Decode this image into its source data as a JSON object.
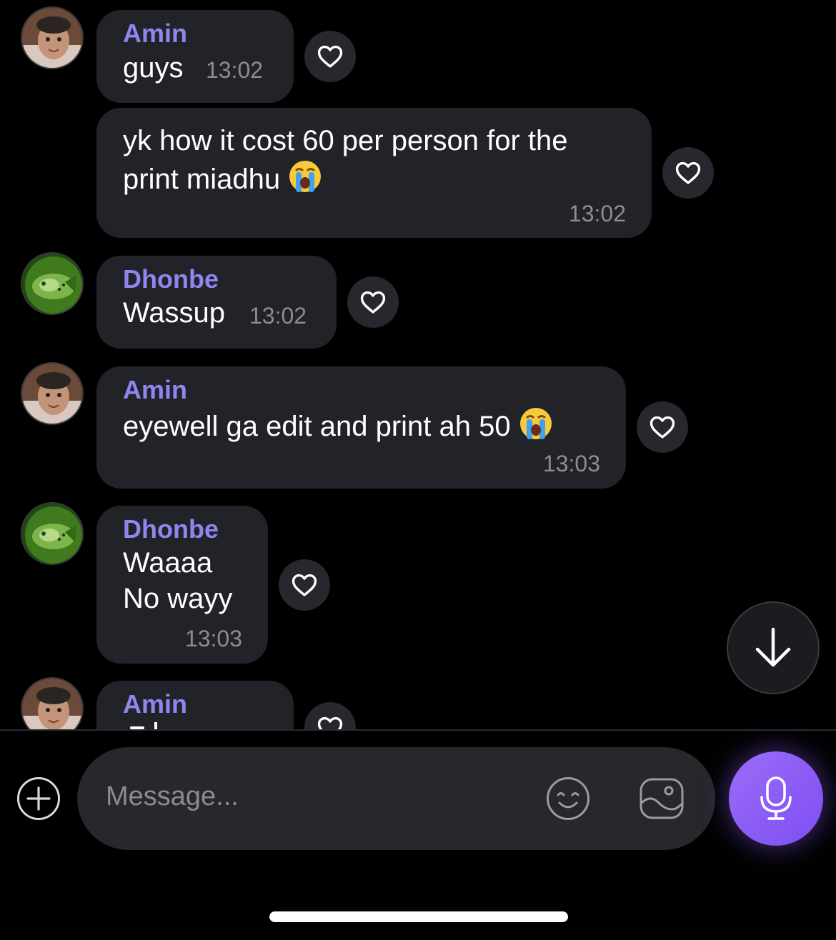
{
  "messages": [
    {
      "sender": "Amin",
      "lines": [
        "guys"
      ],
      "time": "13:02"
    },
    {
      "sender": "",
      "lines": [
        "yk how it cost 60 per person for the",
        "print miadhu"
      ],
      "emoji": "loudly-crying-face",
      "time": "13:02"
    },
    {
      "sender": "Dhonbe",
      "lines": [
        "Wassup"
      ],
      "time": "13:02"
    },
    {
      "sender": "Amin",
      "lines": [
        "eyewell ga edit and print ah 50"
      ],
      "emoji": "loudly-crying-face",
      "time": "13:03"
    },
    {
      "sender": "Dhonbe",
      "lines": [
        "Waaaa",
        "No wayy"
      ],
      "time": "13:03"
    },
    {
      "sender": "Amin",
      "lines": [],
      "time": ""
    }
  ],
  "composer": {
    "placeholder": "Message..."
  },
  "icons": {
    "like": "heart-outline-icon",
    "scroll_down": "arrow-down-icon",
    "attach": "plus-circle-icon",
    "emoji_picker": "smiley-icon",
    "gallery": "image-icon",
    "voice": "microphone-icon"
  },
  "colors": {
    "background": "#000000",
    "bubble": "#212329",
    "sender_name": "#8f87f0",
    "timestamp": "#8b8d93",
    "mic_button": "#8b5cf6"
  }
}
